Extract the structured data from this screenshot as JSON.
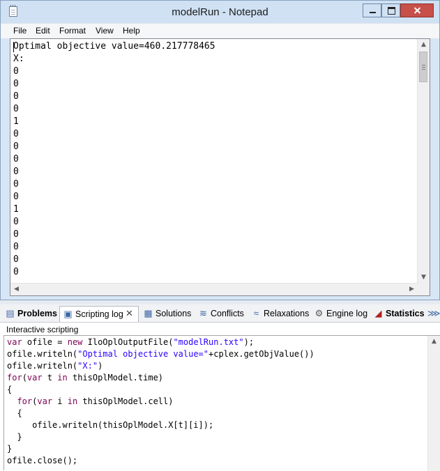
{
  "notepad": {
    "title": "modelRun - Notepad",
    "menu": [
      "File",
      "Edit",
      "Format",
      "View",
      "Help"
    ],
    "content": "Optimal objective value=460.217778465\nX:\n0\n0\n0\n0\n1\n0\n0\n0\n0\n0\n0\n1\n0\n0\n0\n0\n0"
  },
  "ide": {
    "tabs": [
      {
        "label": "Problems",
        "icon": "problems-icon",
        "active": false
      },
      {
        "label": "Scripting log",
        "icon": "scripting-log-icon",
        "active": true
      },
      {
        "label": "Solutions",
        "icon": "solutions-icon",
        "active": false
      },
      {
        "label": "Conflicts",
        "icon": "conflicts-icon",
        "active": false
      },
      {
        "label": "Relaxations",
        "icon": "relaxations-icon",
        "active": false
      },
      {
        "label": "Engine log",
        "icon": "engine-log-icon",
        "active": false
      },
      {
        "label": "Statistics",
        "icon": "statistics-icon",
        "active": false
      }
    ],
    "section_label": "Interactive scripting",
    "code": {
      "l1": {
        "a": "var",
        "b": " ofile = ",
        "c": "new",
        "d": " IloOplOutputFile(",
        "e": "\"modelRun.txt\"",
        "f": ");"
      },
      "l2": {
        "a": "ofile.writeln(",
        "b": "\"Optimal objective value=\"",
        "c": "+cplex.getObjValue())"
      },
      "l3": {
        "a": "ofile.writeln(",
        "b": "\"X:\"",
        "c": ")"
      },
      "l4": {
        "a": "for",
        "b": "(",
        "c": "var",
        "d": " t ",
        "e": "in",
        "f": " thisOplModel.time)"
      },
      "l5": "{",
      "l6": {
        "a": "  ",
        "b": "for",
        "c": "(",
        "d": "var",
        "e": " i ",
        "f": "in",
        "g": " thisOplModel.cell)"
      },
      "l7": "  {",
      "l8": "     ofile.writeln(thisOplModel.X[t][i]);",
      "l9": "  }",
      "l10": "}",
      "l11": "ofile.close();"
    }
  },
  "colors": {
    "keyword": "#7f0055",
    "string": "#2a00ff",
    "close_button": "#c7504a"
  }
}
